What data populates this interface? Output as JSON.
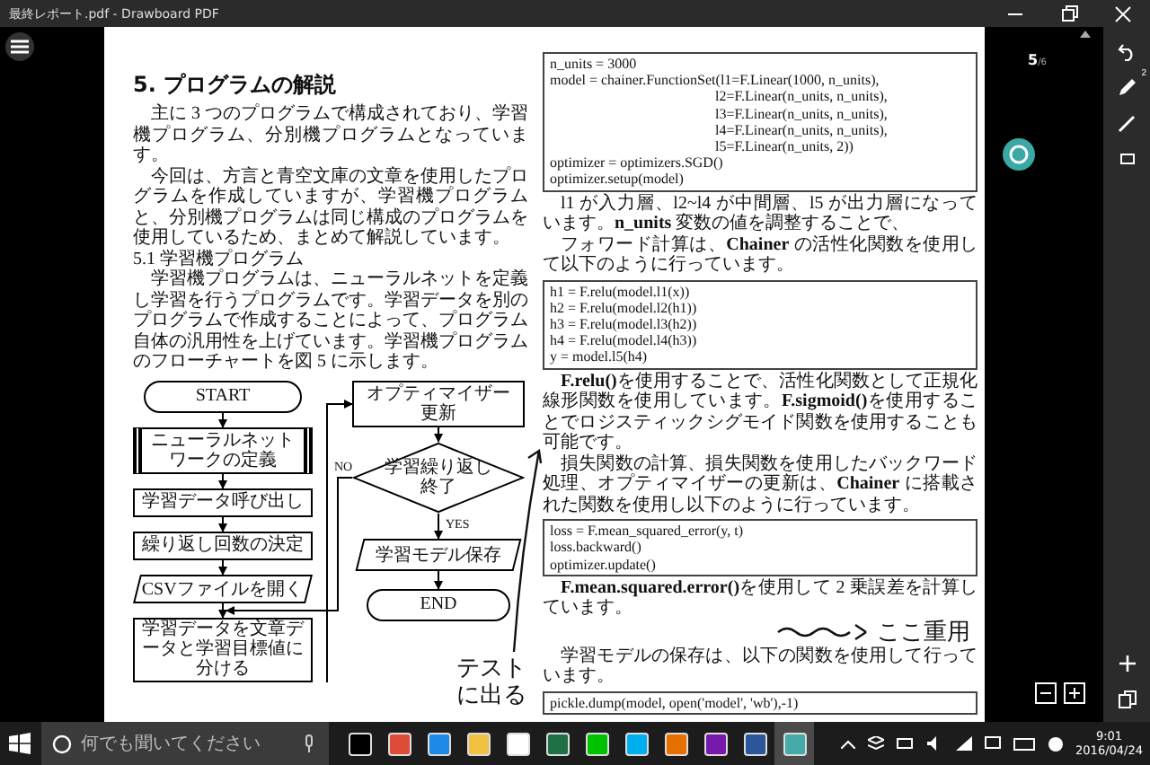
{
  "window": {
    "title": "最終レポート.pdf - Drawboard PDF"
  },
  "document": {
    "left_column": [
      {
        "kind": "heading",
        "text": "5. プログラムの解説"
      },
      {
        "kind": "paragraph",
        "text": "主に 3 つのプログラムで構成されており、学習機プログラム、分別機プログラムとなっています。"
      },
      {
        "kind": "paragraph",
        "text": "今回は、方言と青空文庫の文章を使用したプログラムを作成していますが、学習機プログラムと、分別機プログラムは同じ構成のプログラムを使用しているため、まとめて解説しています。"
      },
      {
        "kind": "subheading",
        "text": "5.1 学習機プログラム"
      },
      {
        "kind": "paragraph",
        "text": "学習機プログラムは、ニューラルネットを定義し学習を行うプログラムです。学習データを別のプログラムで作成することによって、プログラム自体の汎用性を上げています。学習機プログラムのフローチャートを図 5 に示します。"
      }
    ],
    "flowchart": {
      "nodes": [
        {
          "kind": "terminal",
          "text": "START"
        },
        {
          "kind": "predefined",
          "text": "ニューラルネットワークの定義"
        },
        {
          "kind": "process",
          "text": "学習データ呼び出し"
        },
        {
          "kind": "process",
          "text": "繰り返し回数の決定"
        },
        {
          "kind": "data",
          "text": "CSVファイルを開く"
        },
        {
          "kind": "process",
          "text": "学習データを文章データと学習目標値に分ける"
        },
        {
          "kind": "process",
          "text": "オプティマイザー更新"
        },
        {
          "kind": "decision",
          "text": "学習繰り返し終了"
        },
        {
          "kind": "data",
          "text": "学習モデル保存"
        },
        {
          "kind": "terminal",
          "text": "END"
        }
      ],
      "no_label": "NO",
      "yes_label": "YES"
    },
    "right_column": [
      {
        "kind": "code",
        "lines": [
          {
            "text": "n_units = 3000",
            "indented": false
          },
          {
            "text": "model = chainer.FunctionSet(l1=F.Linear(1000, n_units),",
            "indented": false
          },
          {
            "text": "l2=F.Linear(n_units, n_units),",
            "indented": true
          },
          {
            "text": "l3=F.Linear(n_units, n_units),",
            "indented": true
          },
          {
            "text": "l4=F.Linear(n_units, n_units),",
            "indented": true
          },
          {
            "text": "l5=F.Linear(n_units, 2))",
            "indented": true
          },
          {
            "text": "optimizer = optimizers.SGD()",
            "indented": false
          },
          {
            "text": "optimizer.setup(model)",
            "indented": false
          }
        ]
      },
      {
        "kind": "paragraph",
        "text": "l1 が入力層、l2~l4 が中間層、l5 が出力層になっています。**n_units** 変数の値を調整することで、"
      },
      {
        "kind": "paragraph",
        "text": "フォワード計算は、**Chainer** の活性化関数を使用して以下のように行っています。"
      },
      {
        "kind": "code",
        "lines": [
          {
            "text": "h1 = F.relu(model.l1(x))",
            "indented": false
          },
          {
            "text": "h2 = F.relu(model.l2(h1))",
            "indented": false
          },
          {
            "text": "h3 = F.relu(model.l3(h2))",
            "indented": false
          },
          {
            "text": "h4 = F.relu(model.l4(h3))",
            "indented": false
          },
          {
            "text": "y = model.l5(h4)",
            "indented": false
          }
        ]
      },
      {
        "kind": "paragraph",
        "text": "**F.relu()**を使用することで、活性化関数として正規化線形関数を使用しています。**F.sigmoid()**を使用することでロジスティックシグモイド関数を使用することも可能です。"
      },
      {
        "kind": "paragraph",
        "text": "損失関数の計算、損失関数を使用したバックワード処理、オプティマイザーの更新は、**Chainer** に搭載された関数を使用し以下のように行っています。"
      },
      {
        "kind": "code",
        "lines": [
          {
            "text": "loss = F.mean_squared_error(y, t)",
            "indented": false
          },
          {
            "text": "loss.backward()",
            "indented": false
          },
          {
            "text": "optimizer.update()",
            "indented": false
          }
        ]
      },
      {
        "kind": "paragraph",
        "text": "**F.mean.squared.error()**を使用して 2 乗誤差を計算しています。"
      },
      {
        "kind": "handwriting",
        "lines": [
          "ここ重用"
        ]
      },
      {
        "kind": "paragraph",
        "text": "学習モデルの保存は、以下の関数を使用して行っています。"
      },
      {
        "kind": "code",
        "lines": [
          {
            "text": "pickle.dump(model, open('model', 'wb'),-1)",
            "indented": false
          }
        ]
      }
    ],
    "annotations": [
      {
        "lines": [
          "テスト",
          "に出る"
        ]
      }
    ]
  },
  "viewer": {
    "page_number": "5",
    "page_total": "/6",
    "pen_badge": "2"
  },
  "taskbar": {
    "search": {
      "placeholder": "何でも聞いてください"
    },
    "time": "9:01",
    "date": "2016/04/24"
  }
}
